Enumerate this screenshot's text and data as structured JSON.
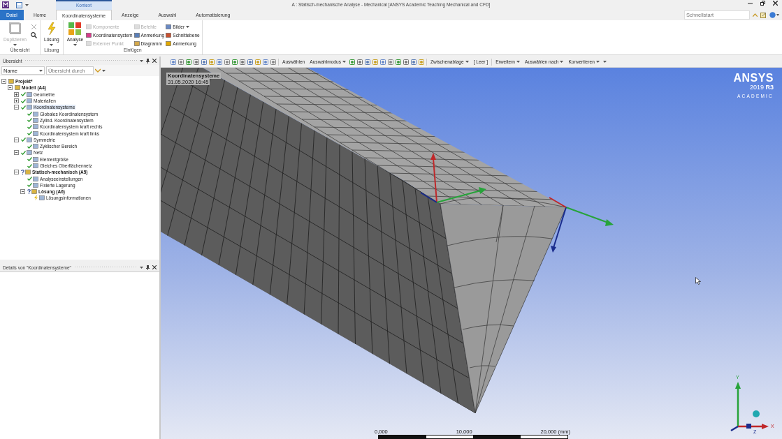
{
  "window": {
    "title": "A : Statisch-mechanische Analyse - Mechanical [ANSYS Academic Teaching Mechanical and CFD]",
    "context_tab": "Kontext",
    "search": {
      "placeholder": "Schnellstart"
    }
  },
  "tabs": [
    {
      "label": "Datei",
      "kind": "file",
      "selected": false
    },
    {
      "label": "Home",
      "kind": "tab",
      "selected": false
    },
    {
      "label": "Koordinatensysteme",
      "kind": "context",
      "selected": true
    },
    {
      "label": "Anzeige",
      "kind": "tab",
      "selected": false
    },
    {
      "label": "Auswahl",
      "kind": "tab",
      "selected": false
    },
    {
      "label": "Automatisierung",
      "kind": "tab",
      "selected": false
    }
  ],
  "ribbon": [
    {
      "label": "Übersicht",
      "items": [
        {
          "kind": "large",
          "label": "Duplizieren",
          "disabled": true,
          "dropdown": true
        },
        {
          "kind": "close",
          "disabled": true
        },
        {
          "kind": "search",
          "disabled": false
        }
      ]
    },
    {
      "label": "Lösung",
      "items": [
        {
          "kind": "large",
          "label": "Lösung",
          "disabled": false,
          "dropdown": true
        }
      ]
    },
    {
      "label": "Einfügen",
      "items": [
        {
          "kind": "large",
          "label": "Analyse",
          "disabled": false,
          "dropdown": true
        },
        {
          "kind": "small",
          "label": "Komponente",
          "disabled": true,
          "dropdown": false
        },
        {
          "kind": "small",
          "label": "Koordinatensystem",
          "disabled": false,
          "dropdown": false
        },
        {
          "kind": "small",
          "label": "Externer Punkt",
          "disabled": true,
          "dropdown": false
        },
        {
          "kind": "small",
          "label": "Befehle",
          "disabled": true,
          "dropdown": false
        },
        {
          "kind": "small",
          "label": "Anmerkung",
          "disabled": false,
          "dropdown": false
        },
        {
          "kind": "small",
          "label": "Diagramm",
          "disabled": false,
          "dropdown": false
        },
        {
          "kind": "small",
          "label": "Bilder",
          "disabled": false,
          "dropdown": true
        },
        {
          "kind": "small",
          "label": "Schnittebene",
          "disabled": false,
          "dropdown": false
        },
        {
          "kind": "small",
          "label": "Anmerkung",
          "disabled": false,
          "dropdown": false
        }
      ]
    }
  ],
  "toolbar": [
    {
      "label": "Auswählen",
      "dropdown": false
    },
    {
      "label": "Auswahlmodus",
      "dropdown": true
    },
    {
      "label": "Zwischenablage",
      "dropdown": true
    },
    {
      "label": "[ Leer ]",
      "dropdown": false
    },
    {
      "label": "Erweitern",
      "dropdown": true
    },
    {
      "label": "Auswählen nach",
      "dropdown": true
    },
    {
      "label": "Konvertieren",
      "dropdown": true
    }
  ],
  "outline": {
    "title": "Übersicht",
    "filter": {
      "value": "Name",
      "placeholder": "Übersicht durch"
    },
    "tree": [
      {
        "label": "Projekt*",
        "bold": true,
        "selected": false,
        "expanded": true,
        "children": [
          {
            "label": "Modell (A4)",
            "bold": true,
            "selected": false,
            "expanded": true,
            "children": [
              {
                "label": "Geometrie",
                "bold": false,
                "kind": "check",
                "selected": false,
                "expanded": false
              },
              {
                "label": "Materialien",
                "bold": false,
                "kind": "check",
                "selected": false,
                "expanded": false
              },
              {
                "label": "Koordinatensysteme",
                "bold": false,
                "kind": "check",
                "selected": true,
                "expanded": true,
                "children": [
                  {
                    "label": "Globales Koordinatensystem",
                    "bold": false,
                    "kind": "check",
                    "selected": false
                  },
                  {
                    "label": "Zylind. Koordinatensystem",
                    "bold": false,
                    "kind": "check",
                    "selected": false
                  },
                  {
                    "label": "Koordinatensystem kraft rechts",
                    "bold": false,
                    "kind": "check",
                    "selected": false
                  },
                  {
                    "label": "Koordinatensystem kraft links",
                    "bold": false,
                    "kind": "check",
                    "selected": false
                  }
                ]
              },
              {
                "label": "Symmetrie",
                "bold": false,
                "kind": "check",
                "selected": false,
                "expanded": true,
                "children": [
                  {
                    "label": "Zyklischer Bereich",
                    "bold": false,
                    "kind": "check",
                    "selected": false
                  }
                ]
              },
              {
                "label": "Netz",
                "bold": false,
                "kind": "check",
                "selected": false,
                "expanded": true,
                "children": [
                  {
                    "label": "Elementgröße",
                    "bold": false,
                    "kind": "check",
                    "selected": false
                  },
                  {
                    "label": "Gleiches Oberflächennetz",
                    "bold": false,
                    "kind": "check",
                    "selected": false
                  }
                ]
              },
              {
                "label": "Statisch-mechanisch (A5)",
                "bold": true,
                "kind": "question",
                "selected": false,
                "expanded": true,
                "children": [
                  {
                    "label": "Analyseeinstellungen",
                    "bold": false,
                    "kind": "check",
                    "selected": false
                  },
                  {
                    "label": "Fixierte Lagerung",
                    "bold": false,
                    "kind": "check",
                    "selected": false
                  },
                  {
                    "label": "Lösung (A6)",
                    "bold": true,
                    "kind": "question",
                    "selected": false,
                    "expanded": true,
                    "children": [
                      {
                        "label": "Lösungsinformationen",
                        "bold": false,
                        "kind": "lightning",
                        "selected": false
                      }
                    ]
                  }
                ]
              }
            ]
          }
        ]
      }
    ]
  },
  "details": {
    "title": "Details von \"Koordinatensysteme\""
  },
  "viewport": {
    "label": "Koordinatensysteme",
    "date": "31.05.2020 16:45",
    "logo": {
      "name": "ANSYS",
      "version": "2019 **R3**",
      "edition": "ACADEMIC"
    },
    "scale_labels": [
      "0,000",
      "10,000",
      "20,000 (mm)"
    ],
    "triad_labels": [
      "Y",
      "X",
      "Z"
    ]
  }
}
